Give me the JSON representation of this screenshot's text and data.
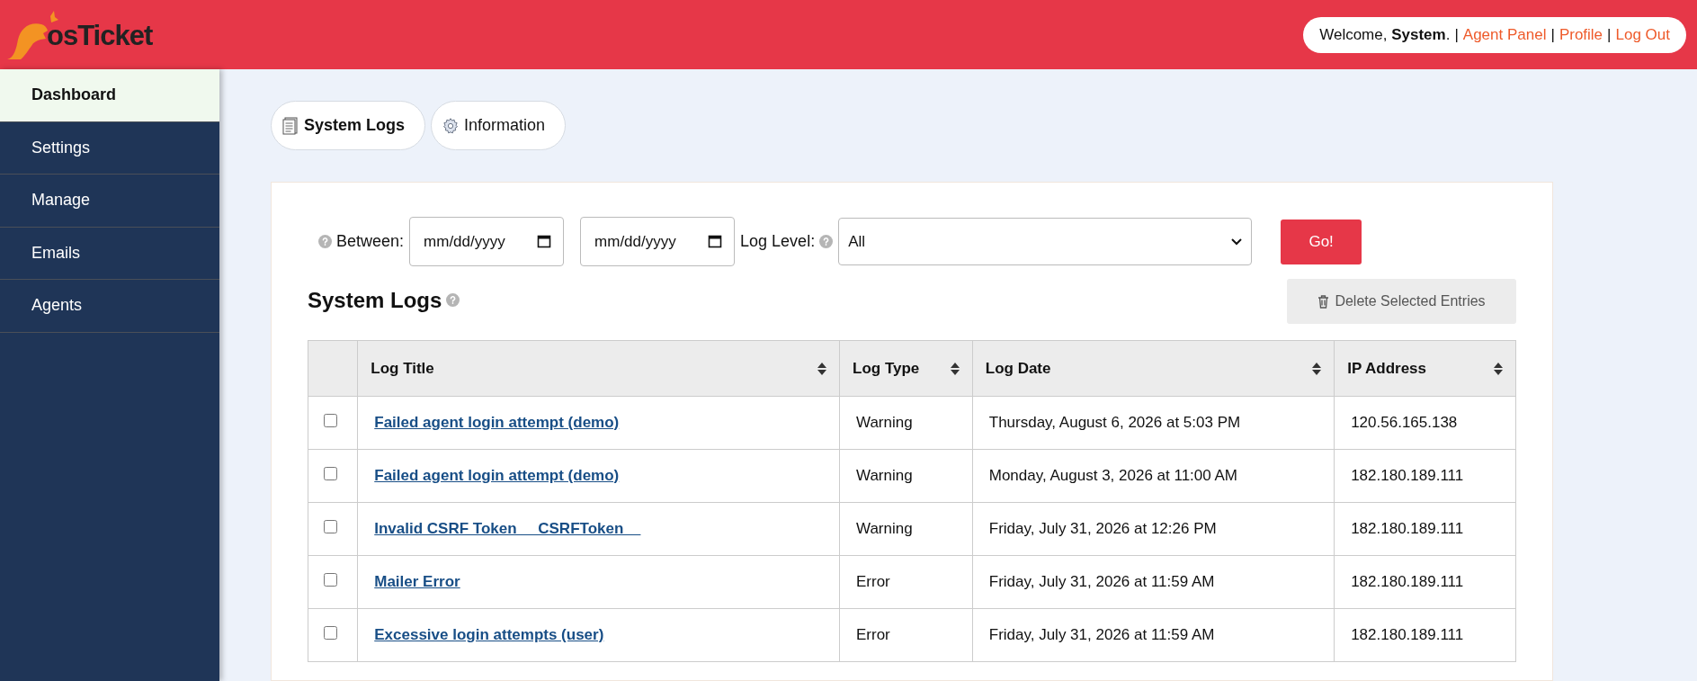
{
  "header": {
    "logo": "osTicket",
    "welcome": "Welcome, **System**.",
    "links": [
      {
        "label": "Agent Panel"
      },
      {
        "label": "Profile"
      },
      {
        "label": "Log Out"
      }
    ],
    "separator": "|"
  },
  "sidebar": {
    "items": [
      {
        "label": "Dashboard",
        "selected": true
      },
      {
        "label": "Settings",
        "selected": false
      },
      {
        "label": "Manage",
        "selected": false
      },
      {
        "label": "Emails",
        "selected": false
      },
      {
        "label": "Agents",
        "selected": false
      }
    ]
  },
  "tabs": [
    {
      "label": "System Logs",
      "kind": "logs",
      "selected": true
    },
    {
      "label": "Information",
      "kind": "info",
      "selected": false
    }
  ],
  "filters": {
    "between_label": "Between:",
    "from": {
      "placeholder": "mm/dd/yyyy"
    },
    "to": {
      "placeholder": "mm/dd/yyyy"
    },
    "level_label": "Log Level:",
    "level_value": "All",
    "go": "Go!"
  },
  "section": {
    "title": "System Logs",
    "delete_button": "Delete Selected Entries"
  },
  "table": {
    "columns": [
      "Log Title",
      "Log Type",
      "Log Date",
      "IP Address"
    ],
    "rows": [
      {
        "title": "Failed agent login attempt (demo)",
        "type": "Warning",
        "date": "Thursday, August 6, 2026 at 5:03 PM",
        "ip": "120.56.165.138",
        "checked": false
      },
      {
        "title": "Failed agent login attempt (demo)",
        "type": "Warning",
        "date": "Monday, August 3, 2026 at 11:00 AM",
        "ip": "182.180.189.111",
        "checked": false
      },
      {
        "title": "Invalid CSRF Token __CSRFToken__",
        "type": "Warning",
        "date": "Friday, July 31, 2026 at 12:26 PM",
        "ip": "182.180.189.111",
        "checked": false
      },
      {
        "title": "Mailer Error",
        "type": "Error",
        "date": "Friday, July 31, 2026 at 11:59 AM",
        "ip": "182.180.189.111",
        "checked": false
      },
      {
        "title": "Excessive login attempts (user)",
        "type": "Error",
        "date": "Friday, July 31, 2026 at 11:59 AM",
        "ip": "182.180.189.111",
        "checked": false
      }
    ]
  }
}
